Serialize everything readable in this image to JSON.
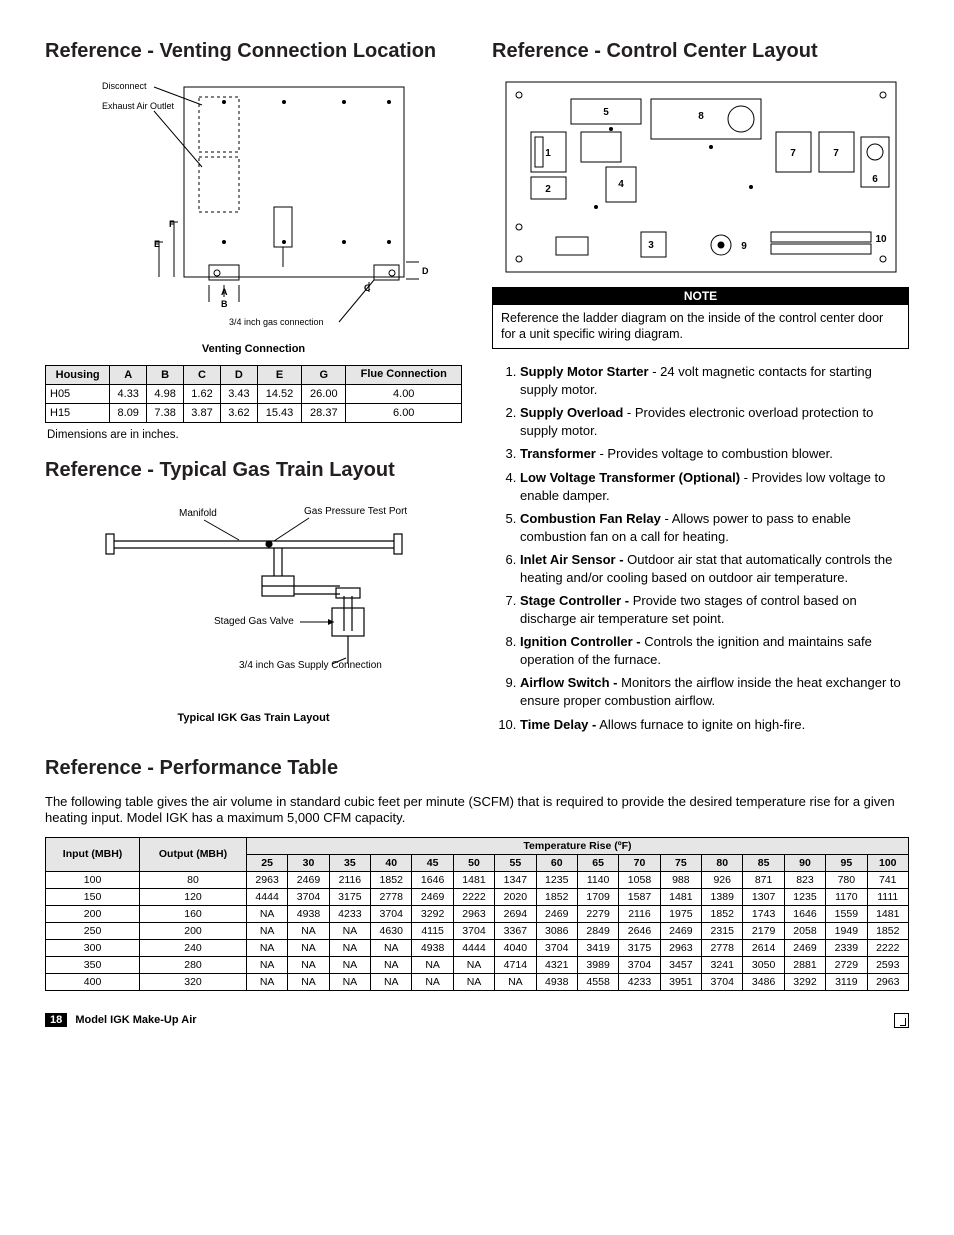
{
  "left": {
    "h_venting": "Reference - Venting Connection Location",
    "vent_labels": {
      "disconnect": "Disconnect",
      "exhaust": "Exhaust Air Outlet",
      "gas_conn": "3/4 inch gas connection",
      "A": "A",
      "B": "B",
      "C": "C",
      "D": "D",
      "E": "E",
      "F": "F"
    },
    "caption_vent": "Venting Connection",
    "vent_table": {
      "headers": [
        "Housing",
        "A",
        "B",
        "C",
        "D",
        "E",
        "G",
        "Flue Connection"
      ],
      "rows": [
        [
          "H05",
          "4.33",
          "4.98",
          "1.62",
          "3.43",
          "14.52",
          "26.00",
          "4.00"
        ],
        [
          "H15",
          "8.09",
          "7.38",
          "3.87",
          "3.62",
          "15.43",
          "28.37",
          "6.00"
        ]
      ]
    },
    "dims_note": "Dimensions are in inches.",
    "h_gastrain": "Reference - Typical Gas Train Layout",
    "gt_labels": {
      "manifold": "Manifold",
      "gpt": "Gas Pressure Test Port",
      "sgv": "Staged Gas Valve",
      "supply": "3/4 inch Gas Supply Connection"
    },
    "caption_gt": "Typical IGK Gas Train Layout"
  },
  "right": {
    "h_control": "Reference - Control Center Layout",
    "note_head": "NOTE",
    "note_body": "Reference the ladder diagram on the inside of the control center door for a unit specific wiring diagram.",
    "items": [
      {
        "b": "Supply Motor Starter",
        "t": " - 24 volt magnetic contacts for starting supply motor."
      },
      {
        "b": "Supply Overload",
        "t": " - Provides electronic overload protection to supply motor."
      },
      {
        "b": "Transformer",
        "t": " - Provides voltage to combustion blower."
      },
      {
        "b": "Low Voltage Transformer (Optional)",
        "t": " - Provides low voltage to enable damper."
      },
      {
        "b": "Combustion Fan Relay",
        "t": " - Allows power to pass to enable combustion fan on a call for heating."
      },
      {
        "b": "Inlet Air Sensor -",
        "t": " Outdoor air stat that automatically controls the heating and/or cooling based on outdoor air temperature."
      },
      {
        "b": "Stage Controller -",
        "t": " Provide two stages of control based on discharge air temperature set point."
      },
      {
        "b": "Ignition Controller -",
        "t": " Controls the ignition and maintains safe operation of the furnace."
      },
      {
        "b": "Airflow Switch -",
        "t": " Monitors the airflow inside the heat exchanger to ensure proper combustion airflow."
      },
      {
        "b": "Time Delay -",
        "t": " Allows furnace to ignite on high-fire."
      }
    ]
  },
  "perf": {
    "h": "Reference - Performance Table",
    "intro": "The following table gives the air volume in standard cubic feet per minute (SCFM) that is required to provide the desired temperature rise for a given heating input. Model IGK has a maximum 5,000 CFM capacity.",
    "head1_input": "Input (MBH)",
    "head1_output": "Output (MBH)",
    "head_span": "Temperature Rise (ºF)",
    "temps": [
      "25",
      "30",
      "35",
      "40",
      "45",
      "50",
      "55",
      "60",
      "65",
      "70",
      "75",
      "80",
      "85",
      "90",
      "95",
      "100"
    ],
    "rows": [
      [
        "100",
        "80",
        "2963",
        "2469",
        "2116",
        "1852",
        "1646",
        "1481",
        "1347",
        "1235",
        "1140",
        "1058",
        "988",
        "926",
        "871",
        "823",
        "780",
        "741"
      ],
      [
        "150",
        "120",
        "4444",
        "3704",
        "3175",
        "2778",
        "2469",
        "2222",
        "2020",
        "1852",
        "1709",
        "1587",
        "1481",
        "1389",
        "1307",
        "1235",
        "1170",
        "1111"
      ],
      [
        "200",
        "160",
        "NA",
        "4938",
        "4233",
        "3704",
        "3292",
        "2963",
        "2694",
        "2469",
        "2279",
        "2116",
        "1975",
        "1852",
        "1743",
        "1646",
        "1559",
        "1481"
      ],
      [
        "250",
        "200",
        "NA",
        "NA",
        "NA",
        "4630",
        "4115",
        "3704",
        "3367",
        "3086",
        "2849",
        "2646",
        "2469",
        "2315",
        "2179",
        "2058",
        "1949",
        "1852"
      ],
      [
        "300",
        "240",
        "NA",
        "NA",
        "NA",
        "NA",
        "4938",
        "4444",
        "4040",
        "3704",
        "3419",
        "3175",
        "2963",
        "2778",
        "2614",
        "2469",
        "2339",
        "2222"
      ],
      [
        "350",
        "280",
        "NA",
        "NA",
        "NA",
        "NA",
        "NA",
        "NA",
        "4714",
        "4321",
        "3989",
        "3704",
        "3457",
        "3241",
        "3050",
        "2881",
        "2729",
        "2593"
      ],
      [
        "400",
        "320",
        "NA",
        "NA",
        "NA",
        "NA",
        "NA",
        "NA",
        "NA",
        "4938",
        "4558",
        "4233",
        "3951",
        "3704",
        "3486",
        "3292",
        "3119",
        "2963"
      ]
    ]
  },
  "footer": {
    "page": "18",
    "model": "Model IGK Make-Up Air"
  },
  "chart_data": [
    {
      "type": "table",
      "title": "Venting Connection dimensions (inches)",
      "categories": [
        "Housing",
        "A",
        "B",
        "C",
        "D",
        "E",
        "G",
        "Flue Connection"
      ],
      "series": [
        {
          "name": "H05",
          "values": [
            "H05",
            4.33,
            4.98,
            1.62,
            3.43,
            14.52,
            26.0,
            4.0
          ]
        },
        {
          "name": "H15",
          "values": [
            "H15",
            8.09,
            7.38,
            3.87,
            3.62,
            15.43,
            28.37,
            6.0
          ]
        }
      ]
    },
    {
      "type": "table",
      "title": "Required SCFM by Temperature Rise (ºF)",
      "xlabel": "Temperature Rise (ºF)",
      "ylabel": "SCFM",
      "categories": [
        25,
        30,
        35,
        40,
        45,
        50,
        55,
        60,
        65,
        70,
        75,
        80,
        85,
        90,
        95,
        100
      ],
      "series": [
        {
          "name": "Input 100 / Output 80",
          "values": [
            2963,
            2469,
            2116,
            1852,
            1646,
            1481,
            1347,
            1235,
            1140,
            1058,
            988,
            926,
            871,
            823,
            780,
            741
          ]
        },
        {
          "name": "Input 150 / Output 120",
          "values": [
            4444,
            3704,
            3175,
            2778,
            2469,
            2222,
            2020,
            1852,
            1709,
            1587,
            1481,
            1389,
            1307,
            1235,
            1170,
            1111
          ]
        },
        {
          "name": "Input 200 / Output 160",
          "values": [
            null,
            4938,
            4233,
            3704,
            3292,
            2963,
            2694,
            2469,
            2279,
            2116,
            1975,
            1852,
            1743,
            1646,
            1559,
            1481
          ]
        },
        {
          "name": "Input 250 / Output 200",
          "values": [
            null,
            null,
            null,
            4630,
            4115,
            3704,
            3367,
            3086,
            2849,
            2646,
            2469,
            2315,
            2179,
            2058,
            1949,
            1852
          ]
        },
        {
          "name": "Input 300 / Output 240",
          "values": [
            null,
            null,
            null,
            null,
            4938,
            4444,
            4040,
            3704,
            3419,
            3175,
            2963,
            2778,
            2614,
            2469,
            2339,
            2222
          ]
        },
        {
          "name": "Input 350 / Output 280",
          "values": [
            null,
            null,
            null,
            null,
            null,
            null,
            4714,
            4321,
            3989,
            3704,
            3457,
            3241,
            3050,
            2881,
            2729,
            2593
          ]
        },
        {
          "name": "Input 400 / Output 320",
          "values": [
            null,
            null,
            null,
            null,
            null,
            null,
            null,
            4938,
            4558,
            4233,
            3951,
            3704,
            3486,
            3292,
            3119,
            2963
          ]
        }
      ]
    }
  ]
}
